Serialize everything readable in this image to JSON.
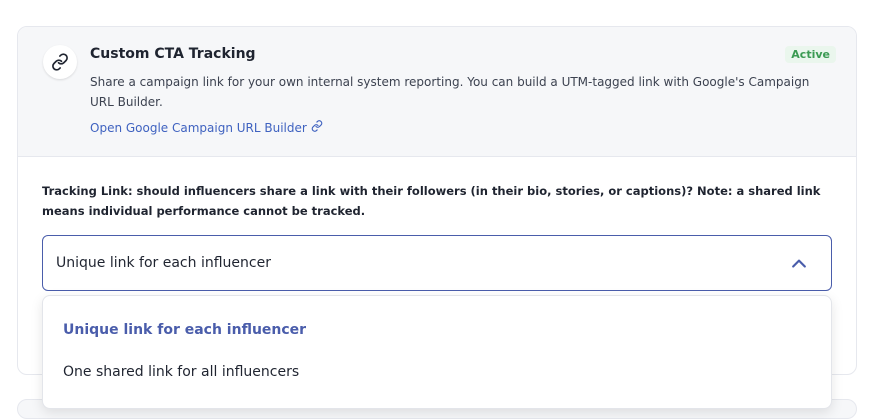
{
  "header": {
    "title": "Custom CTA Tracking",
    "status": "Active",
    "description": "Share a campaign link for your own internal system reporting. You can build a UTM-tagged link with Google's Campaign URL Builder.",
    "link_label": "Open Google Campaign URL Builder",
    "icon": "link-icon",
    "link_icon": "external-link-icon"
  },
  "tracking": {
    "question": "Tracking Link: should influencers share a link with their followers (in their bio, stories, or captions)? Note: a shared link means individual performance cannot be tracked.",
    "selected_value": "Unique link for each influencer",
    "options": [
      "Unique link for each influencer",
      "One shared link for all influencers"
    ]
  },
  "colors": {
    "accent": "#4a5dab",
    "link": "#3f62c0",
    "active_status": "#3a9a52",
    "header_bg": "#f6f7f9"
  }
}
